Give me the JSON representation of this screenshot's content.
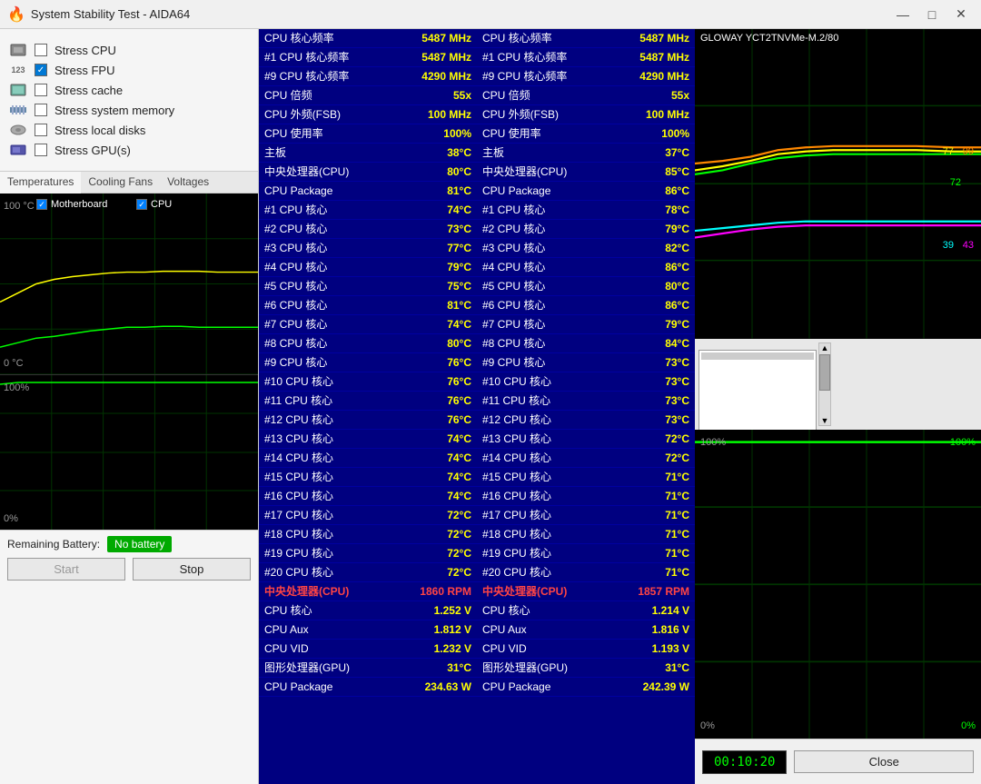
{
  "titleBar": {
    "title": "System Stability Test - AIDA64",
    "icon": "🔥",
    "minimizeLabel": "—",
    "maximizeLabel": "□",
    "closeLabel": "✕"
  },
  "stressOptions": [
    {
      "id": "cpu",
      "label": "Stress CPU",
      "checked": false,
      "icon": "cpu"
    },
    {
      "id": "fpu",
      "label": "Stress FPU",
      "checked": true,
      "icon": "fpu"
    },
    {
      "id": "cache",
      "label": "Stress cache",
      "checked": false,
      "icon": "cache"
    },
    {
      "id": "memory",
      "label": "Stress system memory",
      "checked": false,
      "icon": "mem"
    },
    {
      "id": "disks",
      "label": "Stress local disks",
      "checked": false,
      "icon": "disk"
    },
    {
      "id": "gpu",
      "label": "Stress GPU(s)",
      "checked": false,
      "icon": "gpu"
    }
  ],
  "tabs": [
    "Temperatures",
    "Cooling Fans",
    "Voltages"
  ],
  "chartLabels": {
    "tempTop": "100 °C",
    "tempBottom": "0 °C",
    "utilTop": "100%",
    "utilBottom": "0%"
  },
  "checkboxes": {
    "motherboard": "Motherboard",
    "cpu": "CPU"
  },
  "battery": {
    "label": "Remaining Battery:",
    "value": "No battery"
  },
  "buttons": {
    "start": "Start",
    "stop": "Stop",
    "close": "Close"
  },
  "timer": "00:10:20",
  "leftTable": [
    {
      "label": "CPU 核心频率",
      "value": "5487 MHz"
    },
    {
      "label": "#1 CPU 核心频率",
      "value": "5487 MHz"
    },
    {
      "label": "#9 CPU 核心频率",
      "value": "4290 MHz"
    },
    {
      "label": "CPU 倍频",
      "value": "55x"
    },
    {
      "label": "CPU 外频(FSB)",
      "value": "100 MHz"
    },
    {
      "label": "CPU 使用率",
      "value": "100%"
    },
    {
      "label": "主板",
      "value": "38°C"
    },
    {
      "label": "中央处理器(CPU)",
      "value": "80°C"
    },
    {
      "label": "CPU Package",
      "value": "81°C"
    },
    {
      "label": "#1 CPU 核心",
      "value": "74°C"
    },
    {
      "label": "#2 CPU 核心",
      "value": "73°C"
    },
    {
      "label": "#3 CPU 核心",
      "value": "77°C"
    },
    {
      "label": "#4 CPU 核心",
      "value": "79°C"
    },
    {
      "label": "#5 CPU 核心",
      "value": "75°C"
    },
    {
      "label": "#6 CPU 核心",
      "value": "81°C"
    },
    {
      "label": "#7 CPU 核心",
      "value": "74°C"
    },
    {
      "label": "#8 CPU 核心",
      "value": "80°C"
    },
    {
      "label": "#9 CPU 核心",
      "value": "76°C"
    },
    {
      "label": "#10 CPU 核心",
      "value": "76°C"
    },
    {
      "label": "#11 CPU 核心",
      "value": "76°C"
    },
    {
      "label": "#12 CPU 核心",
      "value": "76°C"
    },
    {
      "label": "#13 CPU 核心",
      "value": "74°C"
    },
    {
      "label": "#14 CPU 核心",
      "value": "74°C"
    },
    {
      "label": "#15 CPU 核心",
      "value": "74°C"
    },
    {
      "label": "#16 CPU 核心",
      "value": "74°C"
    },
    {
      "label": "#17 CPU 核心",
      "value": "72°C"
    },
    {
      "label": "#18 CPU 核心",
      "value": "72°C"
    },
    {
      "label": "#19 CPU 核心",
      "value": "72°C"
    },
    {
      "label": "#20 CPU 核心",
      "value": "72°C"
    },
    {
      "label": "中央处理器(CPU)",
      "value": "1860 RPM",
      "red": true
    },
    {
      "label": "CPU 核心",
      "value": "1.252 V"
    },
    {
      "label": "CPU Aux",
      "value": "1.812 V"
    },
    {
      "label": "CPU VID",
      "value": "1.232 V"
    },
    {
      "label": "图形处理器(GPU)",
      "value": "31°C"
    },
    {
      "label": "CPU Package",
      "value": "234.63 W"
    }
  ],
  "rightTable": [
    {
      "label": "CPU 核心频率",
      "value": "5487 MHz"
    },
    {
      "label": "#1 CPU 核心频率",
      "value": "5487 MHz"
    },
    {
      "label": "#9 CPU 核心频率",
      "value": "4290 MHz"
    },
    {
      "label": "CPU 倍频",
      "value": "55x"
    },
    {
      "label": "CPU 外频(FSB)",
      "value": "100 MHz"
    },
    {
      "label": "CPU 使用率",
      "value": "100%"
    },
    {
      "label": "主板",
      "value": "37°C"
    },
    {
      "label": "中央处理器(CPU)",
      "value": "85°C"
    },
    {
      "label": "CPU Package",
      "value": "86°C"
    },
    {
      "label": "#1 CPU 核心",
      "value": "78°C"
    },
    {
      "label": "#2 CPU 核心",
      "value": "79°C"
    },
    {
      "label": "#3 CPU 核心",
      "value": "82°C"
    },
    {
      "label": "#4 CPU 核心",
      "value": "86°C"
    },
    {
      "label": "#5 CPU 核心",
      "value": "80°C"
    },
    {
      "label": "#6 CPU 核心",
      "value": "86°C"
    },
    {
      "label": "#7 CPU 核心",
      "value": "79°C"
    },
    {
      "label": "#8 CPU 核心",
      "value": "84°C"
    },
    {
      "label": "#9 CPU 核心",
      "value": "73°C"
    },
    {
      "label": "#10 CPU 核心",
      "value": "73°C"
    },
    {
      "label": "#11 CPU 核心",
      "value": "73°C"
    },
    {
      "label": "#12 CPU 核心",
      "value": "73°C"
    },
    {
      "label": "#13 CPU 核心",
      "value": "72°C"
    },
    {
      "label": "#14 CPU 核心",
      "value": "72°C"
    },
    {
      "label": "#15 CPU 核心",
      "value": "71°C"
    },
    {
      "label": "#16 CPU 核心",
      "value": "71°C"
    },
    {
      "label": "#17 CPU 核心",
      "value": "71°C"
    },
    {
      "label": "#18 CPU 核心",
      "value": "71°C"
    },
    {
      "label": "#19 CPU 核心",
      "value": "71°C"
    },
    {
      "label": "#20 CPU 核心",
      "value": "71°C"
    },
    {
      "label": "中央处理器(CPU)",
      "value": "1857 RPM",
      "red": true
    },
    {
      "label": "CPU 核心",
      "value": "1.214 V"
    },
    {
      "label": "CPU Aux",
      "value": "1.816 V"
    },
    {
      "label": "CPU VID",
      "value": "1.193 V"
    },
    {
      "label": "图形处理器(GPU)",
      "value": "31°C"
    },
    {
      "label": "CPU Package",
      "value": "242.39 W"
    }
  ],
  "glowayLabel": "GLOWAY YCT2TNVMe-M.2/80",
  "rightChartValues": {
    "v77": "77",
    "v99": "99",
    "v72": "72",
    "v39": "39",
    "v43": "43"
  }
}
